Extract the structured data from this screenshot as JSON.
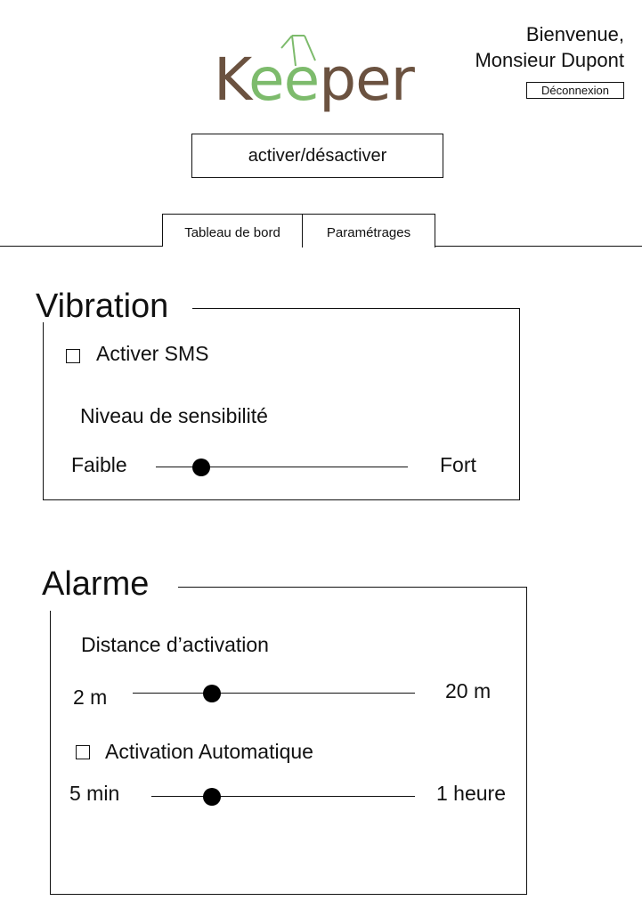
{
  "header": {
    "logo": {
      "text": "Keeper",
      "brown": "#6b5240",
      "green": "#7dbb6c"
    },
    "welcome_line1": "Bienvenue,",
    "welcome_line2": "Monsieur Dupont",
    "logout_label": "Déconnexion"
  },
  "toggle_label": "activer/désactiver",
  "tabs": [
    {
      "label": "Tableau de bord",
      "active": false
    },
    {
      "label": "Paramétrages",
      "active": true
    }
  ],
  "vibration": {
    "title": "Vibration",
    "sms_label": "Activer SMS",
    "sms_checked": false,
    "sensitivity_label": "Niveau de sensibilité",
    "slider": {
      "min_label": "Faible",
      "max_label": "Fort",
      "fraction": 0.18
    }
  },
  "alarm": {
    "title": "Alarme",
    "distance_label": "Distance d’activation",
    "distance_slider": {
      "min_label": "2 m",
      "max_label": "20 m",
      "fraction": 0.28
    },
    "auto_label": "Activation Automatique",
    "auto_checked": false,
    "time_slider": {
      "min_label": "5 min",
      "max_label": "1 heure",
      "fraction": 0.23
    }
  }
}
